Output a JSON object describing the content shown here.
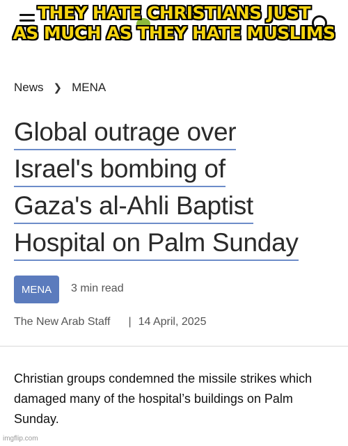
{
  "meme": {
    "caption_line1": "THEY HATE CHRISTIANS JUST",
    "caption_line2": "AS MUCH AS THEY HATE MUSLIMS"
  },
  "breadcrumb": {
    "section": "News",
    "subsection": "MENA"
  },
  "article": {
    "headline_lines": [
      "Global outrage over",
      "Israel's bombing of",
      "Gaza's al-Ahli Baptist",
      "Hospital on Palm Sunday"
    ],
    "tag": "MENA",
    "read_time": "3 min read",
    "author": "The New Arab Staff",
    "divider": "|",
    "date": "14 April, 2025",
    "lede": "Christian groups condemned the missile strikes which damaged many of the hospital’s buildings on Palm Sunday."
  },
  "watermark": "imgflip.com",
  "colors": {
    "caption": "#f5d40f",
    "accent": "#5b7bbd",
    "underline": "#6c8cc9"
  },
  "icons": [
    "menu-icon",
    "logo-icon",
    "search-icon",
    "chevron-right-icon"
  ]
}
